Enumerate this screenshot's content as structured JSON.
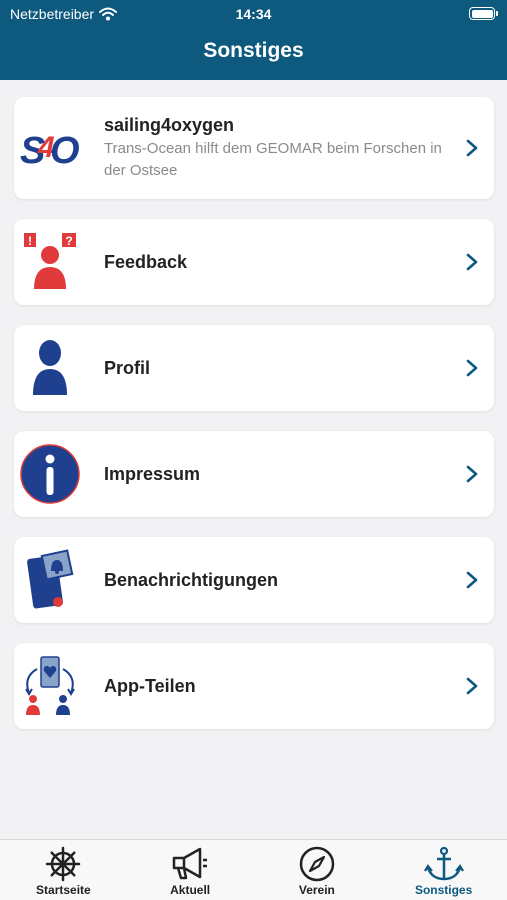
{
  "status": {
    "carrier": "Netzbetreiber",
    "time": "14:34"
  },
  "header": {
    "title": "Sonstiges"
  },
  "menu": [
    {
      "icon": "s4o-logo-icon",
      "label": "sailing4oxygen",
      "subtitle": "Trans-Ocean hilft dem GEOMAR beim Forschen in der Ostsee"
    },
    {
      "icon": "feedback-person-icon",
      "label": "Feedback"
    },
    {
      "icon": "profile-person-icon",
      "label": "Profil"
    },
    {
      "icon": "info-icon",
      "label": "Impressum"
    },
    {
      "icon": "notification-phone-icon",
      "label": "Benachrichtigungen"
    },
    {
      "icon": "share-app-icon",
      "label": "App-Teilen"
    }
  ],
  "s4o_logo": {
    "text_s": "S",
    "text_4": "4",
    "text_o": "O"
  },
  "feedback_icon": {
    "bubble_left": "!",
    "bubble_right": "?"
  },
  "tabs": [
    {
      "label": "Startseite",
      "icon": "ship-wheel-icon",
      "active": false
    },
    {
      "label": "Aktuell",
      "icon": "megaphone-icon",
      "active": false
    },
    {
      "label": "Verein",
      "icon": "compass-icon",
      "active": false
    },
    {
      "label": "Sonstiges",
      "icon": "anchor-icon",
      "active": true
    }
  ],
  "colors": {
    "primary": "#0d5a7e",
    "brand_red": "#e03a3a",
    "brand_blue": "#1f3f8f",
    "background": "#f2f2f4"
  }
}
